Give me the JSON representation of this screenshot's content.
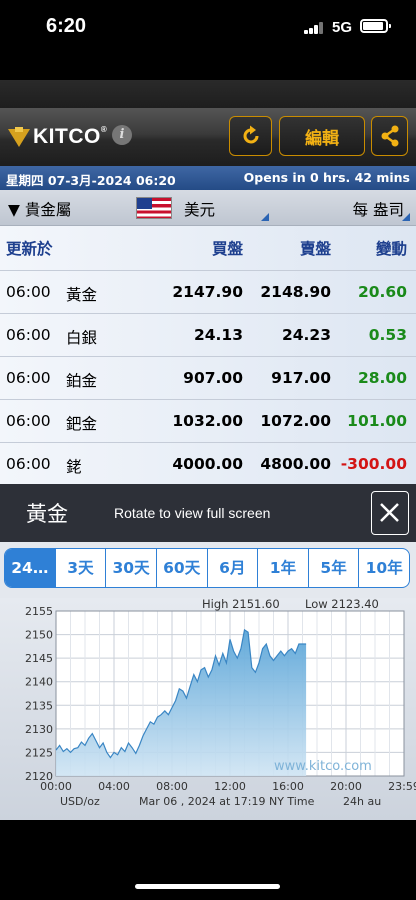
{
  "status": {
    "time": "6:20",
    "network": "5G"
  },
  "toolbar": {
    "logo": "KITCO",
    "edit_label": "編輯"
  },
  "date_bar": {
    "datetime": "星期四 07-3月-2024 06:20",
    "market_status": "Opens in 0 hrs. 42 mins"
  },
  "selector": {
    "metal": "▼ 貴金屬",
    "currency": "美元",
    "unit": "每 盎司"
  },
  "prices": {
    "headers": {
      "updated": "更新於",
      "bid": "買盤",
      "ask": "賣盤",
      "change": "變動"
    },
    "rows": [
      {
        "time": "06:00",
        "name": "黃金",
        "bid": "2147.90",
        "ask": "2148.90",
        "change": "20.60",
        "dir": "up"
      },
      {
        "time": "06:00",
        "name": "白銀",
        "bid": "24.13",
        "ask": "24.23",
        "change": "0.53",
        "dir": "up"
      },
      {
        "time": "06:00",
        "name": "鉑金",
        "bid": "907.00",
        "ask": "917.00",
        "change": "28.00",
        "dir": "up"
      },
      {
        "time": "06:00",
        "name": "鈀金",
        "bid": "1032.00",
        "ask": "1072.00",
        "change": "101.00",
        "dir": "up"
      },
      {
        "time": "06:00",
        "name": "銠",
        "bid": "4000.00",
        "ask": "4800.00",
        "change": "-300.00",
        "dir": "down"
      }
    ]
  },
  "chart_panel": {
    "title": "黃金",
    "rotate_hint": "Rotate to view full screen",
    "tabs": [
      "24…",
      "3天",
      "30天",
      "60天",
      "6月",
      "1年",
      "5年",
      "10年"
    ],
    "active_tab": 0
  },
  "colors": {
    "accent": "#2f80d6",
    "gold": "#f2b114",
    "up": "#1a8a1a",
    "down": "#d31414"
  },
  "chart_data": {
    "type": "area",
    "high_label": "High 2151.60",
    "low_label": "Low 2123.40",
    "watermark": "www.kitco.com",
    "unit_label": "USD/oz",
    "date_label": "Mar 06 , 2024 at 17:19 NY Time",
    "period_label": "24h au",
    "ylim": [
      2120,
      2155
    ],
    "xlim": [
      0,
      24
    ],
    "yticks": [
      2120,
      2125,
      2130,
      2135,
      2140,
      2145,
      2150,
      2155
    ],
    "xtick_labels": [
      "00:00",
      "04:00",
      "08:00",
      "12:00",
      "16:00",
      "20:00",
      "23:59"
    ],
    "grid": true,
    "x": [
      0,
      0.25,
      0.5,
      0.75,
      1.0,
      1.25,
      1.5,
      1.75,
      2.0,
      2.25,
      2.5,
      2.75,
      3.0,
      3.25,
      3.5,
      3.75,
      4.0,
      4.25,
      4.5,
      4.75,
      5.0,
      5.25,
      5.5,
      5.75,
      6.0,
      6.25,
      6.5,
      6.75,
      7.0,
      7.25,
      7.5,
      7.75,
      8.0,
      8.25,
      8.5,
      8.75,
      9.0,
      9.25,
      9.5,
      9.75,
      10.0,
      10.25,
      10.5,
      10.75,
      11.0,
      11.25,
      11.5,
      11.75,
      12.0,
      12.25,
      12.5,
      12.75,
      13.0,
      13.25,
      13.5,
      13.75,
      14.0,
      14.25,
      14.5,
      14.75,
      15.0,
      15.25,
      15.5,
      15.75,
      16.0,
      16.25,
      16.5,
      16.75,
      17.0,
      17.25
    ],
    "y": [
      2125.5,
      2126.5,
      2125.2,
      2125.8,
      2125.0,
      2125.8,
      2126.0,
      2127.2,
      2126.5,
      2128.0,
      2129.0,
      2127.5,
      2126.0,
      2127.0,
      2125.0,
      2123.9,
      2125.0,
      2124.5,
      2126.0,
      2125.2,
      2127.0,
      2126.0,
      2124.8,
      2126.5,
      2128.5,
      2130.0,
      2131.5,
      2131.0,
      2132.5,
      2133.0,
      2133.8,
      2133.0,
      2134.5,
      2136.0,
      2138.5,
      2138.0,
      2136.5,
      2139.0,
      2141.5,
      2140.0,
      2142.5,
      2143.0,
      2141.0,
      2142.5,
      2145.5,
      2143.5,
      2146.0,
      2144.0,
      2149.0,
      2146.5,
      2145.0,
      2147.0,
      2151.0,
      2150.5,
      2143.0,
      2142.0,
      2144.0,
      2147.0,
      2148.0,
      2145.5,
      2144.5,
      2145.5,
      2146.5,
      2145.5,
      2146.5,
      2147.0,
      2146.0,
      2148.0,
      2148.0,
      2148.0
    ]
  }
}
